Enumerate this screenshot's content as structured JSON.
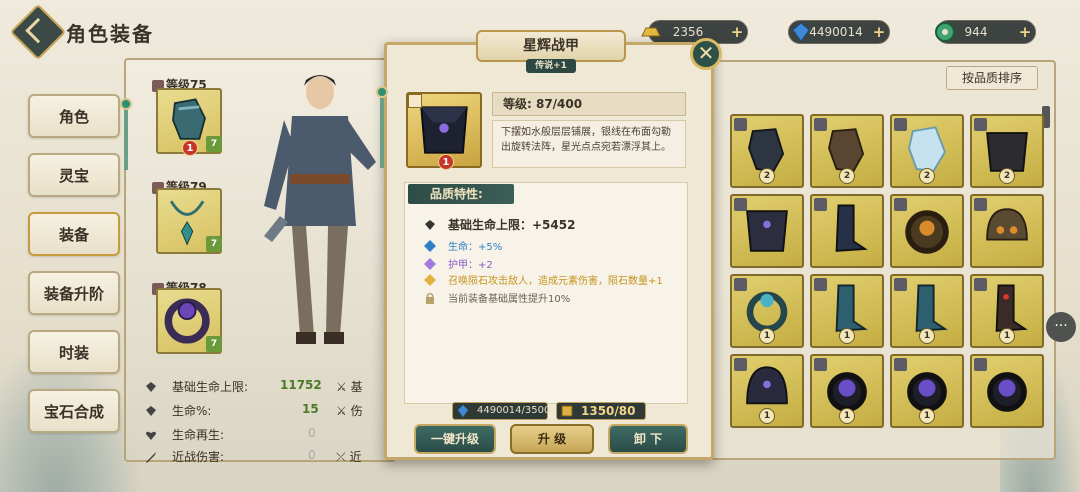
{
  "header": {
    "title": "角色装备"
  },
  "currencies": [
    {
      "name": "ingot",
      "value": "2356",
      "plus": "+"
    },
    {
      "name": "crystal",
      "value": "4490014",
      "plus": "+"
    },
    {
      "name": "jade",
      "value": "944",
      "plus": "+"
    }
  ],
  "nav": [
    "角色",
    "灵宝",
    "装备",
    "装备升阶",
    "时装",
    "宝石合成"
  ],
  "equipped": [
    {
      "level": "等级75",
      "badge": "1",
      "tier": "7"
    },
    {
      "level": "等级79",
      "tier": "7"
    },
    {
      "level": "等级78",
      "tier": "7"
    }
  ],
  "stats": [
    {
      "label": "基础生命上限:",
      "value": "11752",
      "label2": "基"
    },
    {
      "label": "生命%:",
      "value": "15",
      "label2": "伤"
    },
    {
      "label": "生命再生:",
      "value": "0"
    },
    {
      "label": "近战伤害:",
      "value": "0",
      "label2": "近"
    }
  ],
  "popup": {
    "title": "星辉战甲",
    "rarity": "传说+1",
    "close": "✕",
    "item_badge": "1",
    "level": "等级:  87/400",
    "description": "下摆如水般层层铺展，银线在布面勾勒出旋转法阵，星光点点宛若漂浮其上。",
    "quality_header": "品质特性:",
    "base_stat": "基础生命上限：+5452",
    "lines": [
      {
        "text": "生命：+5%",
        "color": "#2f7fc6"
      },
      {
        "text": "护甲：+2",
        "color": "#8b5cc9"
      },
      {
        "text": "召唤陨石攻击敌人，造成元素伤害，陨石数量+1",
        "color": "#c7931f"
      },
      {
        "text": "当前装备基础属性提升10%",
        "color": "#6b6252"
      }
    ],
    "cost_crystal": "4490014/3500",
    "cost_gold": "1350/80",
    "btn_auto": "一键升级",
    "btn_upgrade": "升  级",
    "btn_unequip": "卸  下"
  },
  "inventory": {
    "sort_label": "按品质排序",
    "counts": [
      "2",
      "2",
      "2",
      "2",
      "",
      "1",
      "1",
      "1",
      "1",
      "1",
      "1",
      "1",
      "",
      "",
      "",
      "",
      ""
    ]
  },
  "chat": "···",
  "colors": {
    "accent": "#c5a768",
    "teal": "#2d5049",
    "gold_cell": "#d7c161"
  }
}
